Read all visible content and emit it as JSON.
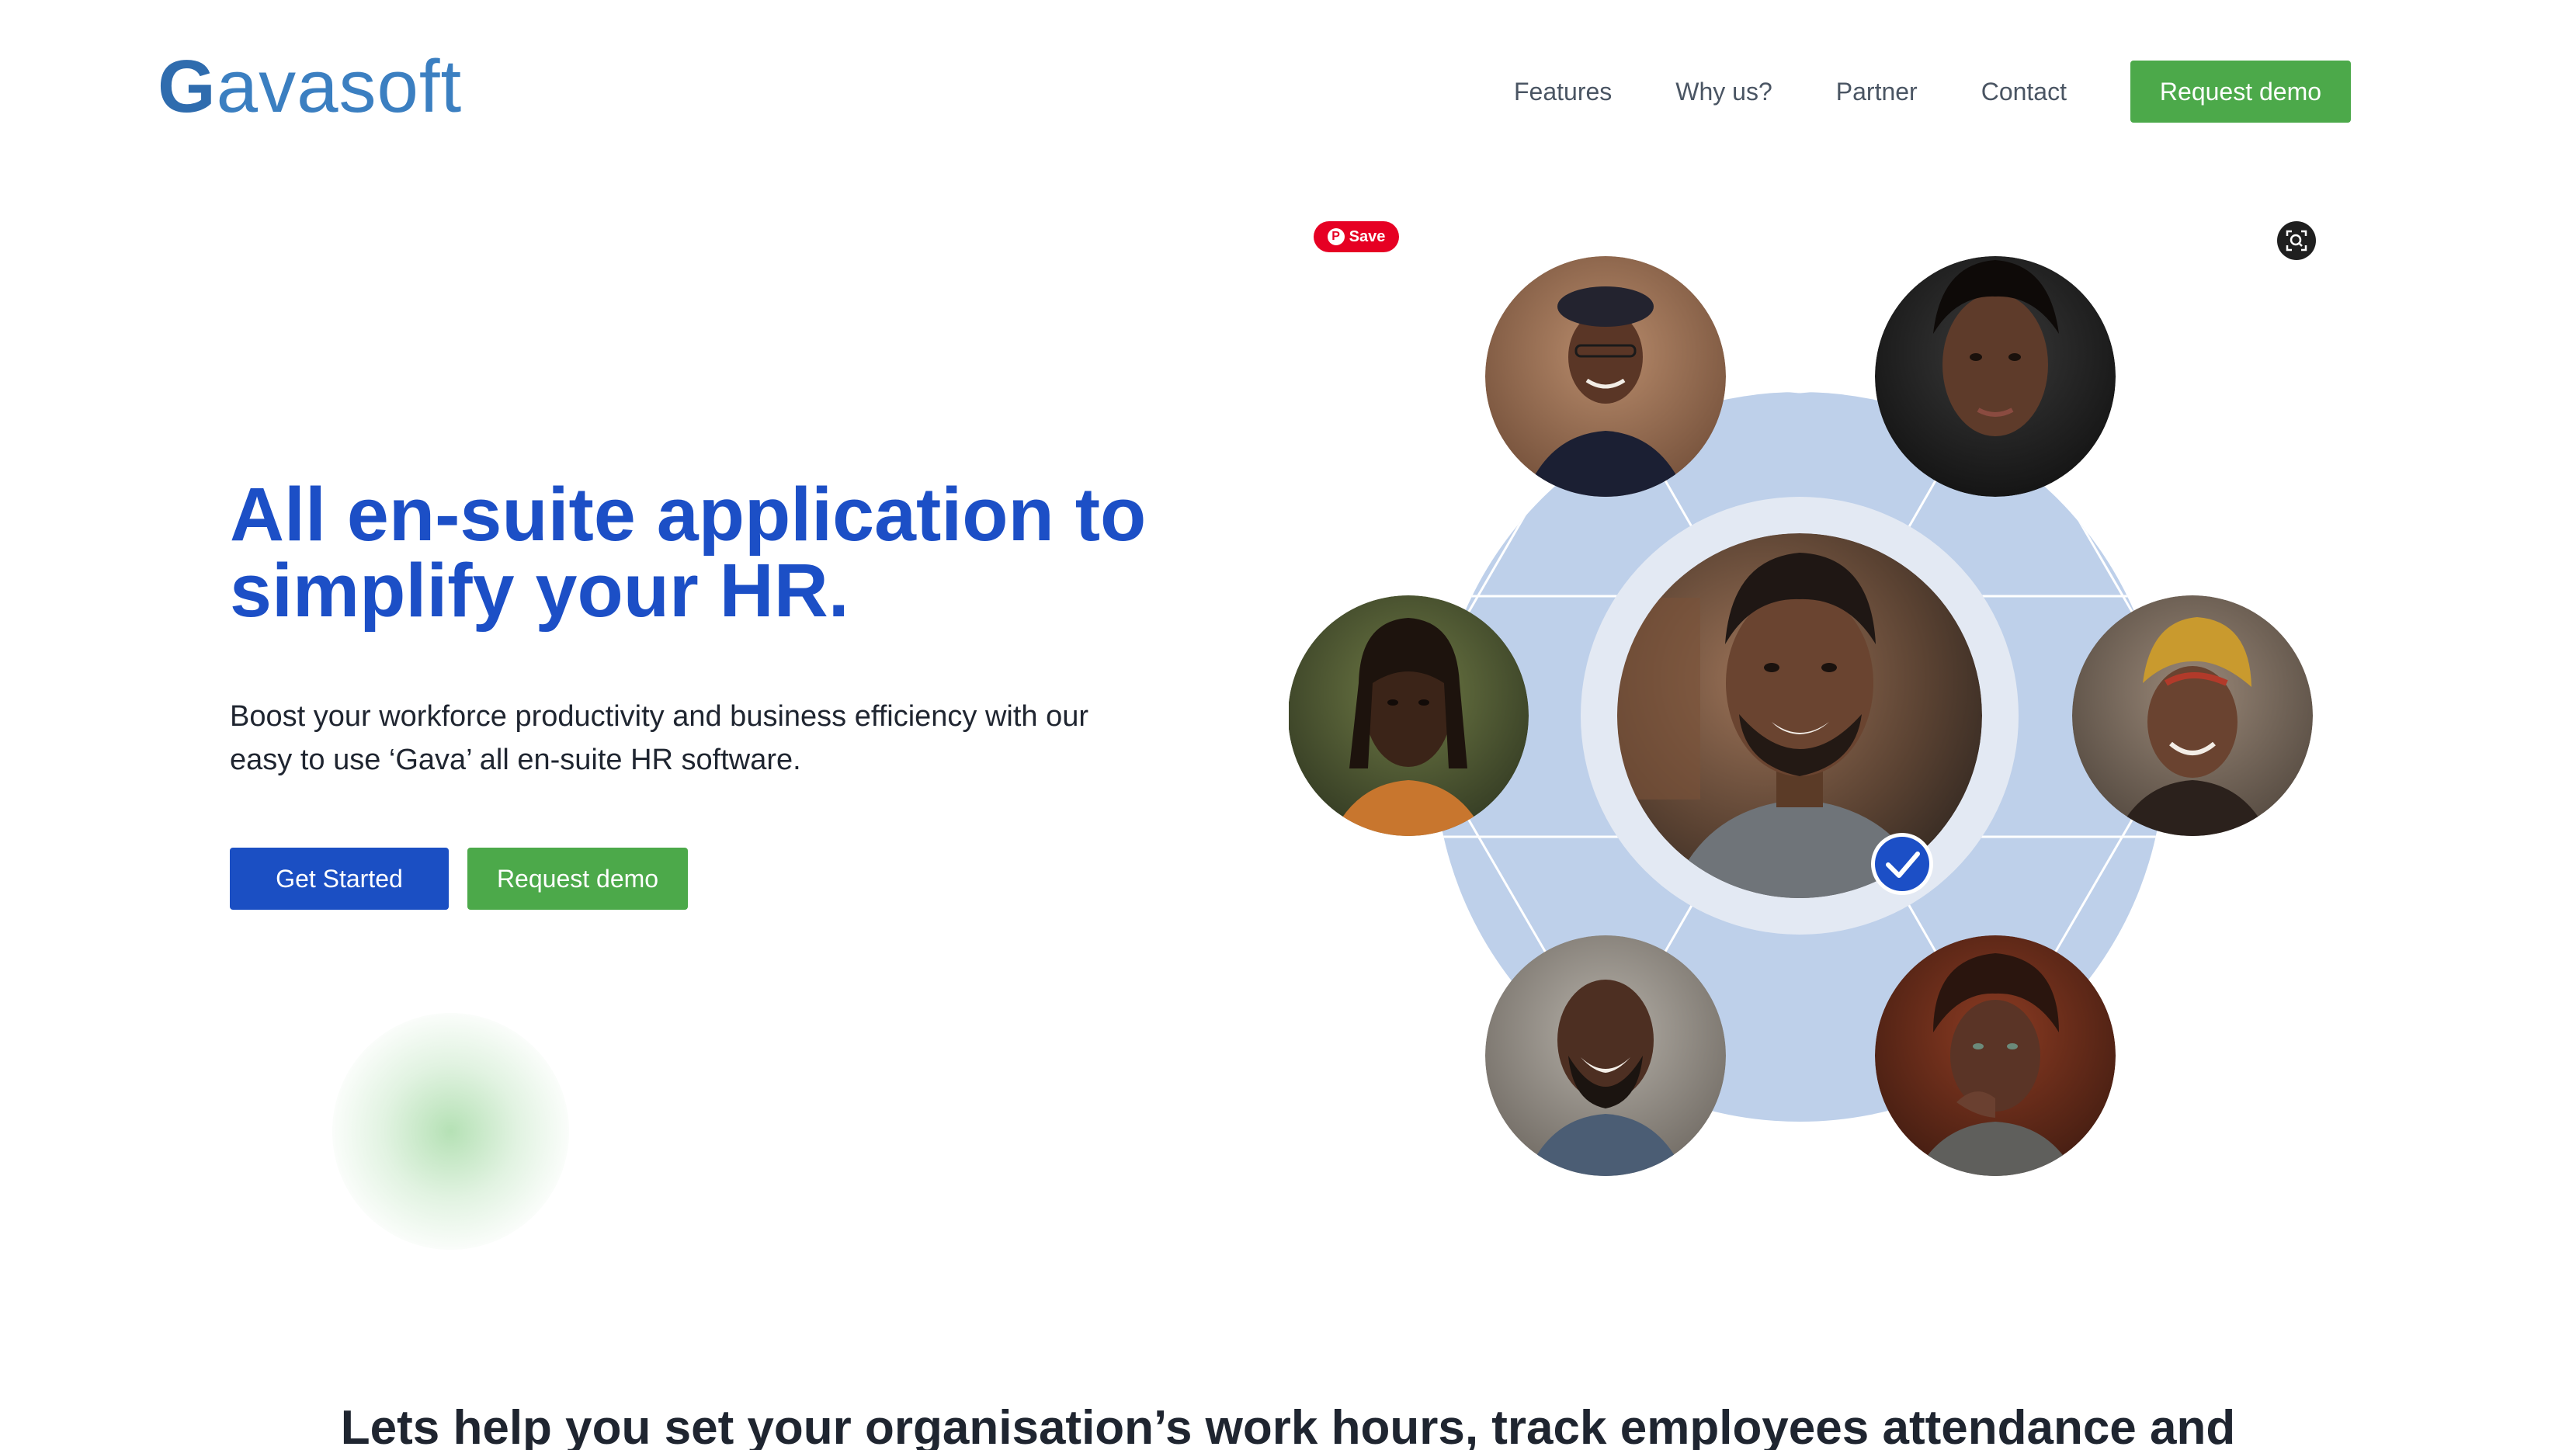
{
  "brand": {
    "logo_initial": "G",
    "logo_rest": "avasoft"
  },
  "nav": {
    "items": [
      "Features",
      "Why us?",
      "Partner",
      "Contact"
    ],
    "cta_label": "Request demo"
  },
  "hero": {
    "title": "All en-suite application to simplify your HR.",
    "description": "Boost your workforce productivity and business efficiency with our easy to use ‘Gava’ all en-suite HR software.",
    "primary_button": "Get Started",
    "secondary_button": "Request demo"
  },
  "overlay": {
    "save_label": "Save",
    "save_icon": "pinterest-icon",
    "lens_icon": "visual-search-icon"
  },
  "illustration": {
    "avatars": [
      "avatar-top-left",
      "avatar-top-right",
      "avatar-middle-left",
      "avatar-center",
      "avatar-middle-right",
      "avatar-bottom-left",
      "avatar-bottom-right"
    ],
    "selected_avatar": "avatar-center",
    "badge_icon": "check-icon"
  },
  "section": {
    "heading": "Lets help you set your organisation’s work hours, track employees attendance and"
  },
  "colors": {
    "brand_blue": "#1c4fc6",
    "button_blue": "#1b4fc3",
    "button_green": "#4ca94a",
    "circle_fill": "#bed0ea",
    "ring_fill": "#e3e9f3",
    "pinterest_red": "#e60023"
  }
}
